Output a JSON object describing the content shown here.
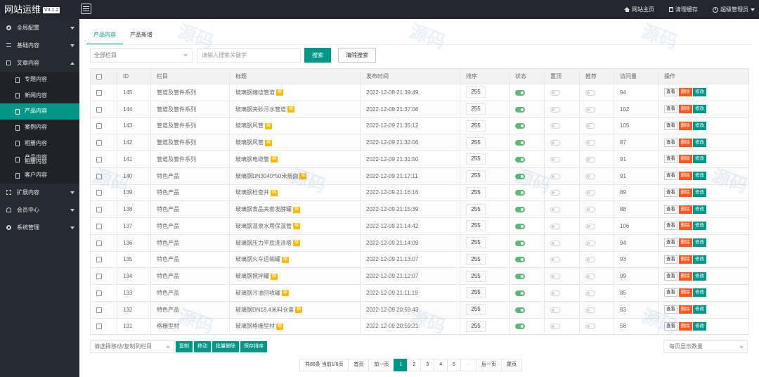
{
  "header": {
    "logo": "网站运维",
    "version": "V3.1.2",
    "home_link": "网站主页",
    "clear_cache": "清理缓存",
    "admin": "超级管理员"
  },
  "sidebar": {
    "groups": [
      {
        "label": "全局配置",
        "icon": "gear-icon"
      },
      {
        "label": "基础内容",
        "icon": "sliders-icon"
      },
      {
        "label": "文章内容",
        "icon": "document-icon",
        "expanded": true
      }
    ],
    "items": [
      {
        "label": "专题内容"
      },
      {
        "label": "新闻内容"
      },
      {
        "label": "产品内容",
        "active": true
      },
      {
        "label": "案例内容"
      },
      {
        "label": "相册内容"
      },
      {
        "label": "产品内容",
        "overlap": "相册内容"
      },
      {
        "label": "客户内容"
      }
    ],
    "groups_after": [
      {
        "label": "扩展内容",
        "icon": "expand-icon"
      },
      {
        "label": "会员中心",
        "icon": "user-icon"
      },
      {
        "label": "系统管理",
        "icon": "gear-icon"
      }
    ]
  },
  "tabs": [
    {
      "label": "产品内容",
      "active": true
    },
    {
      "label": "产品新增",
      "active": false
    }
  ],
  "filter": {
    "category_select": "全部栏目",
    "search_placeholder": "请输入搜索关键字",
    "search_button": "搜索",
    "clear_button": "清除搜索"
  },
  "table": {
    "columns": [
      "",
      "ID",
      "栏目",
      "标题",
      "发布时间",
      "排序",
      "状态",
      "置顶",
      "推荐",
      "访问量",
      "操作"
    ],
    "new_badge": "缩",
    "actions": {
      "view": "查看",
      "delete": "删除",
      "edit": "修改"
    },
    "rows": [
      {
        "id": "145",
        "category": "管道及管件系列",
        "title": "玻璃钢缠绕管道",
        "time": "2022-12-09 21:39:49",
        "sort": "255",
        "status": true,
        "top": false,
        "recommend": false,
        "views": "94"
      },
      {
        "id": "144",
        "category": "管道及管件系列",
        "title": "玻璃钢夹砂污水管道",
        "time": "2022-12-09 21:37:06",
        "sort": "255",
        "status": true,
        "top": false,
        "recommend": false,
        "views": "102"
      },
      {
        "id": "143",
        "category": "管道及管件系列",
        "title": "玻璃钢风管",
        "time": "2022-12-09 21:35:12",
        "sort": "255",
        "status": true,
        "top": false,
        "recommend": false,
        "views": "105"
      },
      {
        "id": "142",
        "category": "管道及管件系列",
        "title": "玻璃钢风管",
        "time": "2022-12-09 21:32:06",
        "sort": "255",
        "status": true,
        "top": false,
        "recommend": false,
        "views": "87"
      },
      {
        "id": "141",
        "category": "管道及管件系列",
        "title": "玻璃钢电缆管",
        "time": "2022-12-09 21:31:50",
        "sort": "255",
        "status": true,
        "top": false,
        "recommend": false,
        "views": "91"
      },
      {
        "id": "140",
        "category": "特色产品",
        "title": "玻璃钢DN3040*50米烟囱",
        "time": "2022-12-09 21:17:11",
        "sort": "255",
        "status": true,
        "top": false,
        "recommend": false,
        "views": "91"
      },
      {
        "id": "139",
        "category": "特色产品",
        "title": "玻璃钢检查井",
        "time": "2022-12-09 21:16:16",
        "sort": "255",
        "status": true,
        "top": false,
        "recommend": false,
        "views": "89"
      },
      {
        "id": "138",
        "category": "特色产品",
        "title": "玻璃钢食品夹套发酵罐",
        "time": "2022-12-09 21:15:39",
        "sort": "255",
        "status": true,
        "top": false,
        "recommend": false,
        "views": "88"
      },
      {
        "id": "137",
        "category": "特色产品",
        "title": "玻璃钢温泉水用保温管",
        "time": "2022-12-09 21:14:42",
        "sort": "255",
        "status": true,
        "top": false,
        "recommend": false,
        "views": "106"
      },
      {
        "id": "136",
        "category": "特色产品",
        "title": "玻璃钢压力平底洗涤塔",
        "time": "2022-12-09 21:14:09",
        "sort": "255",
        "status": true,
        "top": false,
        "recommend": false,
        "views": "94"
      },
      {
        "id": "135",
        "category": "特色产品",
        "title": "玻璃钢火车运输罐",
        "time": "2022-12-09 21:13:07",
        "sort": "255",
        "status": true,
        "top": false,
        "recommend": false,
        "views": "93"
      },
      {
        "id": "134",
        "category": "特色产品",
        "title": "玻璃钢搅拌罐",
        "time": "2022-12-09 21:12:07",
        "sort": "255",
        "status": true,
        "top": false,
        "recommend": false,
        "views": "99"
      },
      {
        "id": "133",
        "category": "特色产品",
        "title": "玻璃钢污油回收罐",
        "time": "2022-12-09 21:11:19",
        "sort": "255",
        "status": true,
        "top": false,
        "recommend": false,
        "views": "85"
      },
      {
        "id": "132",
        "category": "特色产品",
        "title": "玻璃钢DN18.4米料仓盖",
        "time": "2022-12-09 20:59:43",
        "sort": "255",
        "status": true,
        "top": false,
        "recommend": false,
        "views": "83"
      },
      {
        "id": "131",
        "category": "格栅型材",
        "title": "玻璃钢格栅型材",
        "time": "2022-12-09 20:59:21",
        "sort": "255",
        "status": true,
        "top": false,
        "recommend": false,
        "views": "58"
      }
    ]
  },
  "bottom": {
    "move_select": "请选择移动/复制到栏目",
    "copy": "复制",
    "move": "移动",
    "batch_delete": "批量删除",
    "save_sort": "保存排序",
    "per_page": "每页显示数量"
  },
  "pager": {
    "info": "共88条 当前1/6页",
    "first": "首页",
    "prev": "前一页",
    "pages": [
      "1",
      "2",
      "3",
      "4",
      "5"
    ],
    "current": "1",
    "dots": "···",
    "next": "后一页",
    "last": "尾页"
  },
  "watermark": {
    "text": "源码"
  },
  "colors": {
    "brand": "#009688",
    "danger": "#ff5722",
    "badge": "#ffb800",
    "switch_on": "#5fb878",
    "sidebar": "#262a33",
    "topbar": "#23262e"
  }
}
